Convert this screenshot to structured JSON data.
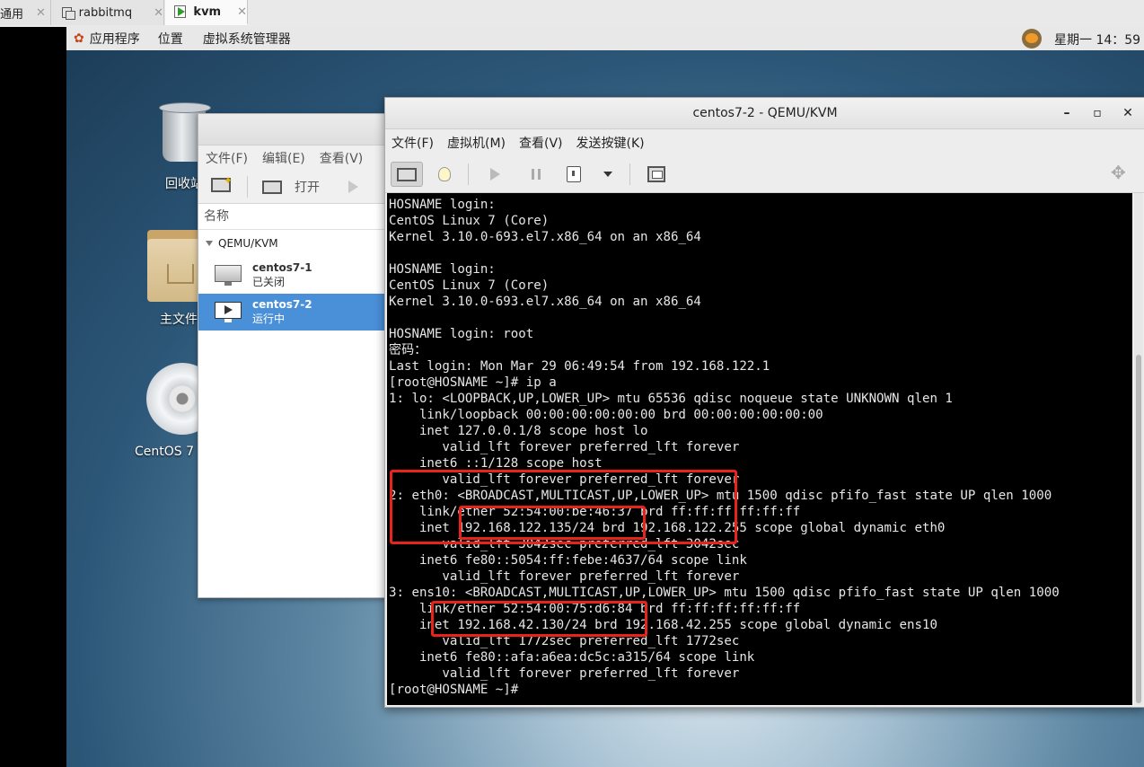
{
  "host_tabs": [
    {
      "label": "通用"
    },
    {
      "label": "rabbitmq"
    },
    {
      "label": "kvm"
    }
  ],
  "gnome_bar": {
    "applications": "应用程序",
    "places": "位置",
    "vmm": "虚拟系统管理器",
    "clock": "星期一 14：59"
  },
  "desktop_icons": {
    "trash": "回收站",
    "home": "主文件",
    "cdrom": "CentOS 7 x"
  },
  "virt_manager": {
    "menu": [
      "文件(F)",
      "编辑(E)",
      "查看(V)"
    ],
    "open_label": "打开",
    "column_name": "名称",
    "group": "QEMU/KVM",
    "vms": [
      {
        "name": "centos7-1",
        "status": "已关闭"
      },
      {
        "name": "centos7-2",
        "status": "运行中"
      }
    ]
  },
  "qemu_window": {
    "title": "centos7-2 - QEMU/KVM",
    "menu": [
      "文件(F)",
      "虚拟机(M)",
      "查看(V)",
      "发送按键(K)"
    ],
    "terminal_text": "HOSNAME login:\nCentOS Linux 7 (Core)\nKernel 3.10.0-693.el7.x86_64 on an x86_64\n\nHOSNAME login:\nCentOS Linux 7 (Core)\nKernel 3.10.0-693.el7.x86_64 on an x86_64\n\nHOSNAME login: root\n密码：\nLast login: Mon Mar 29 06:49:54 from 192.168.122.1\n[root@HOSNAME ~]# ip a\n1: lo: <LOOPBACK,UP,LOWER_UP> mtu 65536 qdisc noqueue state UNKNOWN qlen 1\n    link/loopback 00:00:00:00:00:00 brd 00:00:00:00:00:00\n    inet 127.0.0.1/8 scope host lo\n       valid_lft forever preferred_lft forever\n    inet6 ::1/128 scope host\n       valid_lft forever preferred_lft forever\n2: eth0: <BROADCAST,MULTICAST,UP,LOWER_UP> mtu 1500 qdisc pfifo_fast state UP qlen 1000\n    link/ether 52:54:00:be:46:37 brd ff:ff:ff:ff:ff:ff\n    inet 192.168.122.135/24 brd 192.168.122.255 scope global dynamic eth0\n       valid_lft 3042sec preferred_lft 3042sec\n    inet6 fe80::5054:ff:febe:4637/64 scope link\n       valid_lft forever preferred_lft forever\n3: ens10: <BROADCAST,MULTICAST,UP,LOWER_UP> mtu 1500 qdisc pfifo_fast state UP qlen 1000\n    link/ether 52:54:00:75:d6:84 brd ff:ff:ff:ff:ff:ff\n    inet 192.168.42.130/24 brd 192.168.42.255 scope global dynamic ens10\n       valid_lft 1772sec preferred_lft 1772sec\n    inet6 fe80::afa:a6ea:dc5c:a315/64 scope link\n       valid_lft forever preferred_lft forever\n[root@HOSNAME ~]#"
  },
  "colors": {
    "selection": "#4a90d9",
    "highlight_box": "#e8231a",
    "terminal_bg": "#000000",
    "terminal_fg": "#e6e6e6"
  }
}
